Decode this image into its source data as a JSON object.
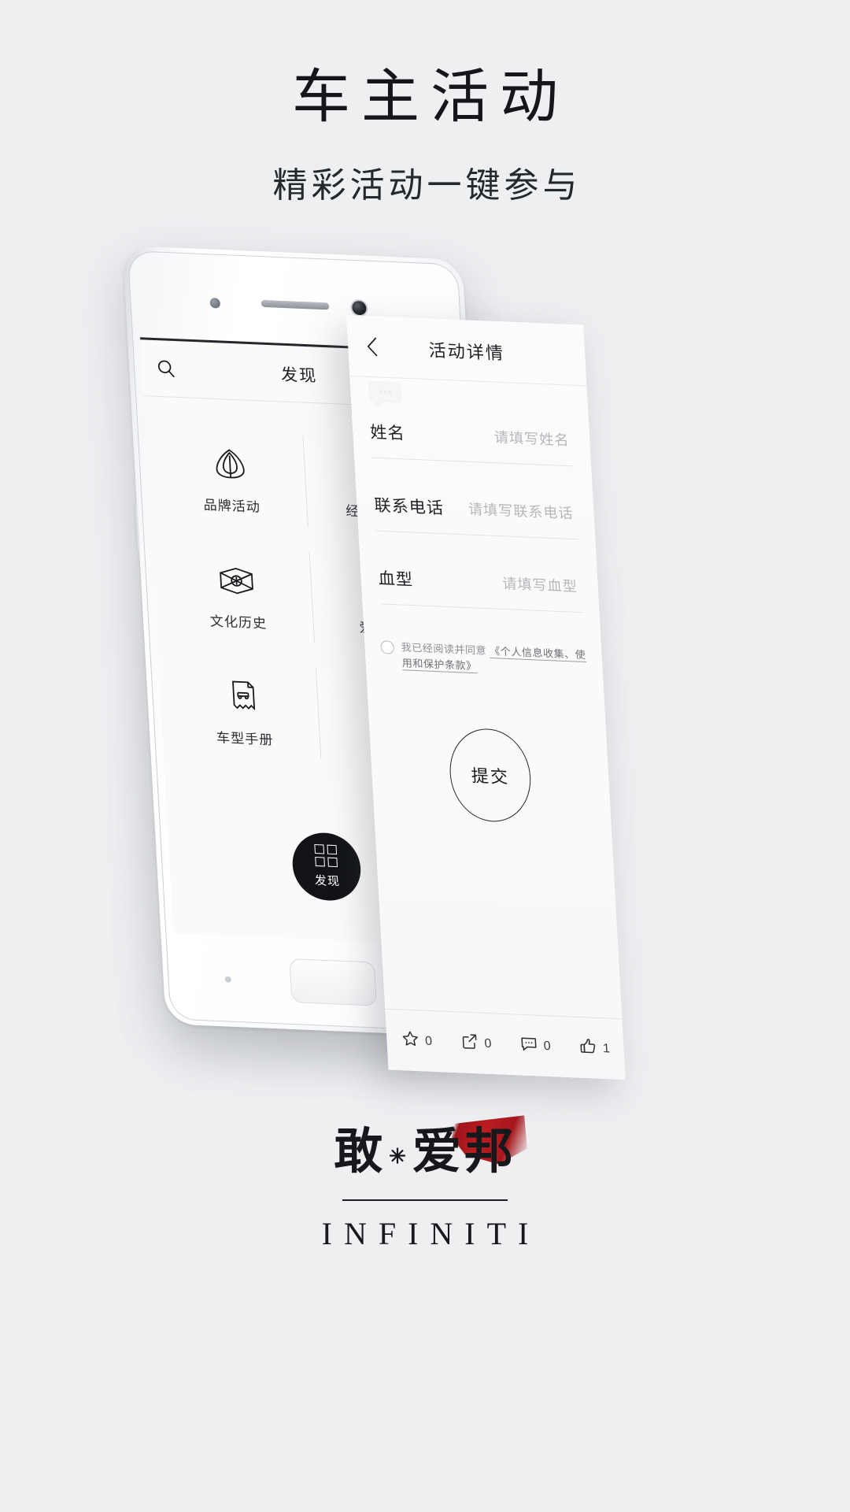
{
  "hero": {
    "title": "车主活动",
    "subtitle": "精彩活动一键参与"
  },
  "phone": {
    "discover": {
      "search_icon": "search-icon",
      "title": "发现",
      "grid": [
        {
          "icon": "infiniti-emblem-icon",
          "label": "品牌活动"
        },
        {
          "icon": "user-star-icon",
          "label": "经销商活动"
        },
        {
          "icon": "scroll-history-icon",
          "label": "文化历史"
        },
        {
          "icon": "car-icon",
          "label": "爱车世界"
        },
        {
          "icon": "manual-book-icon",
          "label": "车型手册"
        },
        {
          "icon": "",
          "label": ""
        }
      ],
      "tab": {
        "icon": "grid-squares-icon",
        "label": "发现"
      }
    }
  },
  "card": {
    "back_icon": "chevron-left-icon",
    "title": "活动详情",
    "fields": [
      {
        "label": "姓名",
        "placeholder": "请填写姓名",
        "value": ""
      },
      {
        "label": "联系电话",
        "placeholder": "请填写联系电话",
        "value": ""
      },
      {
        "label": "血型",
        "placeholder": "请填写血型",
        "value": ""
      }
    ],
    "agreement": {
      "checked": false,
      "text": "我已经阅读并同意",
      "link": "《个人信息收集、使用和保护条款》"
    },
    "submit_label": "提交",
    "footer": [
      {
        "icon": "star-icon",
        "count": "0"
      },
      {
        "icon": "share-icon",
        "count": "0"
      },
      {
        "icon": "comment-icon",
        "count": "0"
      },
      {
        "icon": "thumbs-up-icon",
        "count": "1"
      }
    ]
  },
  "brand": {
    "mark_left": "敢",
    "mark_dot": "✳",
    "mark_right": "爱邦",
    "name": "INFINITI",
    "accent_color": "#b01b21"
  }
}
